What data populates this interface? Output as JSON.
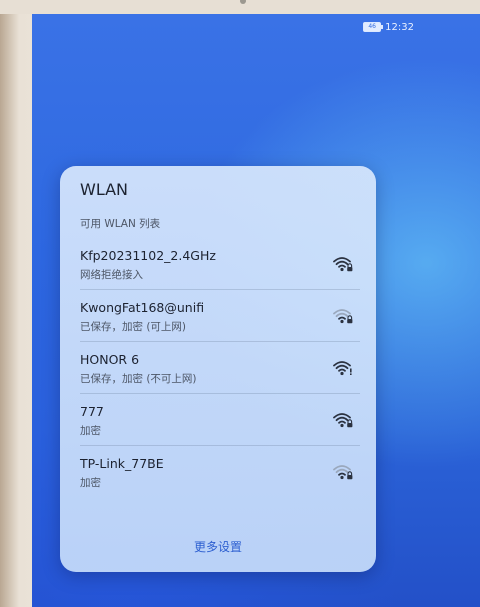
{
  "status_bar": {
    "battery": "46",
    "time": "12:32"
  },
  "dialog": {
    "title": "WLAN",
    "subtitle": "可用 WLAN 列表",
    "more_settings": "更多设置"
  },
  "networks": [
    {
      "name": "Kfp20231102_2.4GHz",
      "status": "网络拒绝接入",
      "signal": 4,
      "icon": "wifi-lock-icon"
    },
    {
      "name": "KwongFat168@unifi",
      "status": "已保存，加密 (可上网)",
      "signal": 2,
      "icon": "wifi-lock-icon"
    },
    {
      "name": "HONOR 6",
      "status": "已保存，加密 (不可上网)",
      "signal": 4,
      "icon": "wifi-warning-icon"
    },
    {
      "name": "777",
      "status": "加密",
      "signal": 4,
      "icon": "wifi-lock-icon"
    },
    {
      "name": "TP-Link_77BE",
      "status": "加密",
      "signal": 2,
      "icon": "wifi-lock-icon"
    }
  ]
}
